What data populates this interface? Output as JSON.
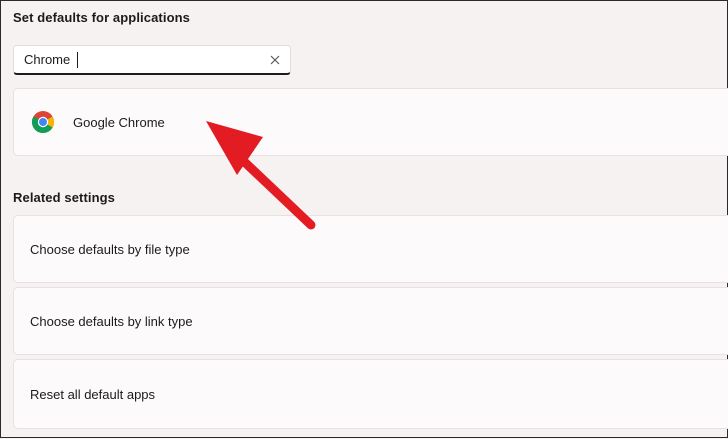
{
  "sections": {
    "defaults_title": "Set defaults for applications",
    "related_title": "Related settings"
  },
  "search": {
    "value": "Chrome",
    "clear_icon": "close-icon"
  },
  "results": [
    {
      "name": "Google Chrome",
      "icon": "chrome-icon"
    }
  ],
  "related_settings": [
    {
      "label": "Choose defaults by file type"
    },
    {
      "label": "Choose defaults by link type"
    },
    {
      "label": "Reset all default apps"
    }
  ],
  "annotation": {
    "arrow_color": "#e31b23"
  },
  "colors": {
    "background": "#f6f2f1",
    "card": "#fcfafa"
  }
}
